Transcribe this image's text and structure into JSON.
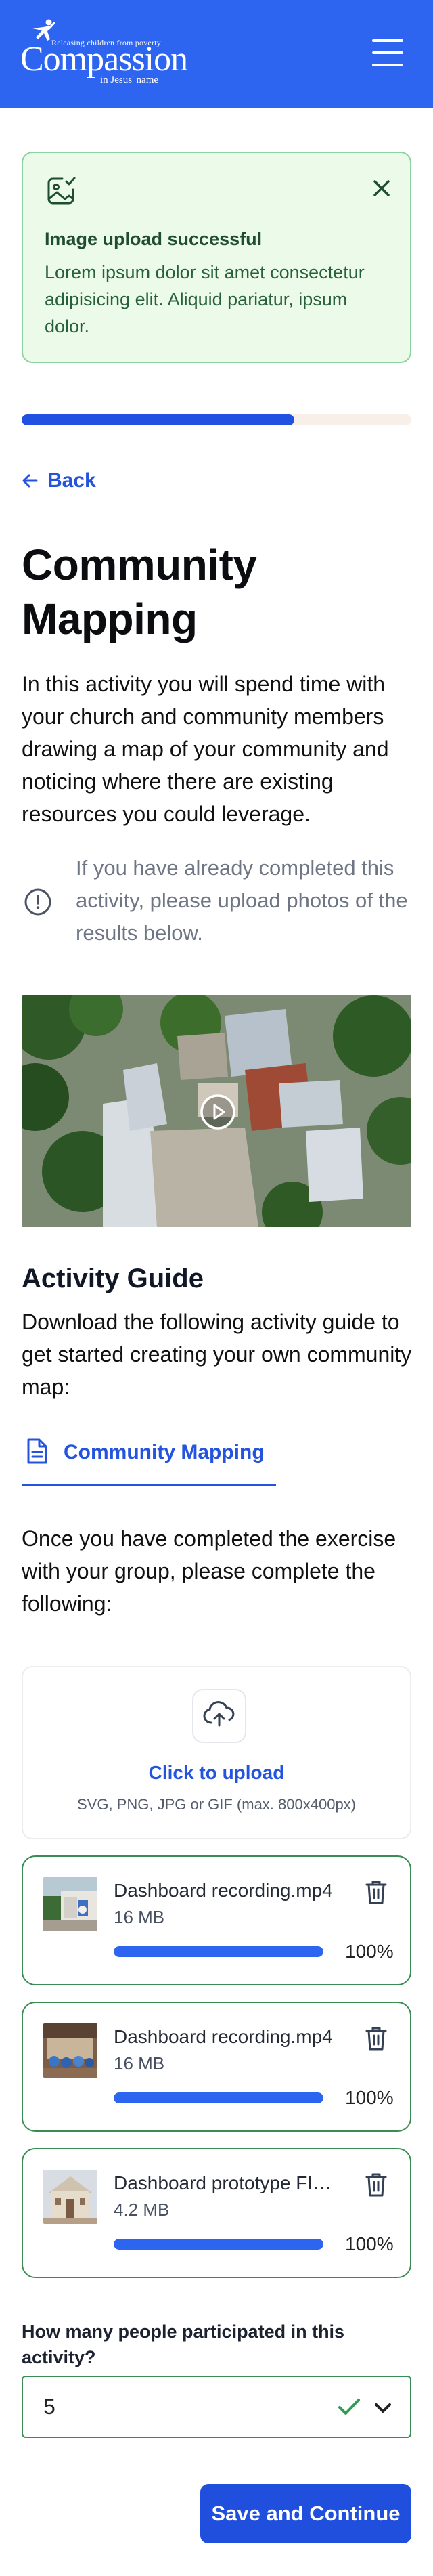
{
  "header": {
    "logo_tagline": "Releasing children from poverty",
    "logo_wordmark": "Compassion",
    "logo_sub": "in Jesus' name",
    "menu_icon": "hamburger-menu-icon",
    "background": "#2d64f0"
  },
  "alert": {
    "icon": "image-check-icon",
    "title": "Image upload successful",
    "message": "Lorem ipsum dolor sit amet consectetur adipisicing elit. Aliquid pariatur, ipsum dolor.",
    "close_icon": "close-icon",
    "background": "#ecfae9",
    "border": "#8cd3a0"
  },
  "progress": {
    "fraction": 0.7,
    "color": "#2151e0"
  },
  "back_label": "Back",
  "page_title": "Community Mapping",
  "intro": "In this activity you will spend time with your church and community members drawing a map of your community and noticing where there are existing resources you could leverage.",
  "note": "If you have already completed this activity, please upload photos of the results below.",
  "video": {
    "icon": "play-icon"
  },
  "guide": {
    "heading": "Activity Guide",
    "text": "Download the following activity guide to get started creating your own community map:",
    "link_label": "Community Mapping",
    "link_icon": "document-icon"
  },
  "instructions": "Once you have completed the exercise with your group, please complete the following:",
  "upload": {
    "icon": "upload-cloud-icon",
    "click_label": "Click to upload",
    "hint": "SVG, PNG, JPG or GIF (max. 800x400px)"
  },
  "files": [
    {
      "name": "Dashboard recording.mp4",
      "size": "16 MB",
      "progress_label": "100%",
      "progress": 1.0
    },
    {
      "name": "Dashboard recording.mp4",
      "size": "16 MB",
      "progress_label": "100%",
      "progress": 1.0
    },
    {
      "name": "Dashboard prototype FINAL.fig",
      "size": "4.2 MB",
      "progress_label": "100%",
      "progress": 1.0
    }
  ],
  "question": {
    "label": "How many people participated in this activity?",
    "value": "5"
  },
  "save_label": "Save and Continue",
  "colors": {
    "accent": "#2453dd",
    "success": "#3b8c54",
    "button": "#1f4fdc"
  }
}
